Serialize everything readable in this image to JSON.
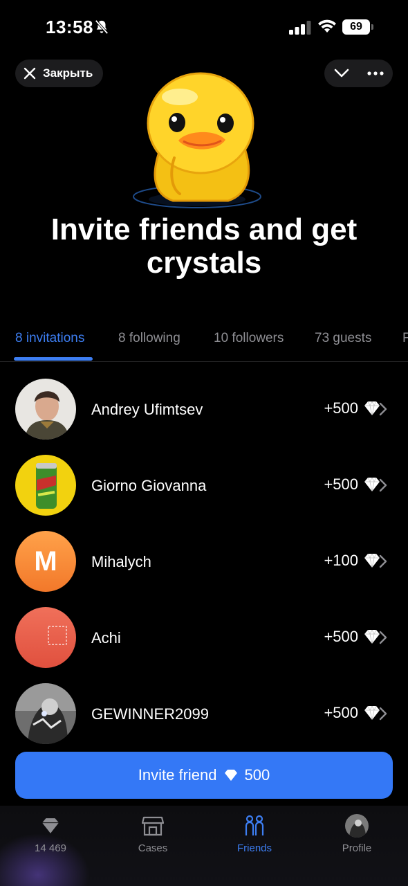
{
  "status": {
    "time": "13:58",
    "battery": "69"
  },
  "top": {
    "close_label": "Закрыть"
  },
  "headline": "Invite friends and get crystals",
  "tabs": [
    {
      "label": "8 invitations",
      "active": true
    },
    {
      "label": "8 following",
      "active": false
    },
    {
      "label": "10 followers",
      "active": false
    },
    {
      "label": "73 guests",
      "active": false
    },
    {
      "label": "F",
      "active": false
    }
  ],
  "friends": [
    {
      "name": "Andrey Ufimtsev",
      "reward": "+500",
      "avatar": "photo"
    },
    {
      "name": "Giorno Giovanna",
      "reward": "+500",
      "avatar": "soda-can"
    },
    {
      "name": "Mihalych",
      "reward": "+100",
      "avatar_letter": "M"
    },
    {
      "name": "Achi",
      "reward": "+500",
      "avatar": "placeholder-glyph"
    },
    {
      "name": "GEWINNER2099",
      "reward": "+500",
      "avatar": "photo"
    }
  ],
  "cta": {
    "label": "Invite friend",
    "amount": "500"
  },
  "nav": [
    {
      "label": "14 469",
      "icon": "crystal-icon",
      "active": false
    },
    {
      "label": "Cases",
      "icon": "store-icon",
      "active": false
    },
    {
      "label": "Friends",
      "icon": "friends-icon",
      "active": true
    },
    {
      "label": "Profile",
      "icon": "avatar",
      "active": false
    }
  ],
  "colors": {
    "accent": "#3d7ef2",
    "button": "#3478f6",
    "background": "#000000"
  }
}
